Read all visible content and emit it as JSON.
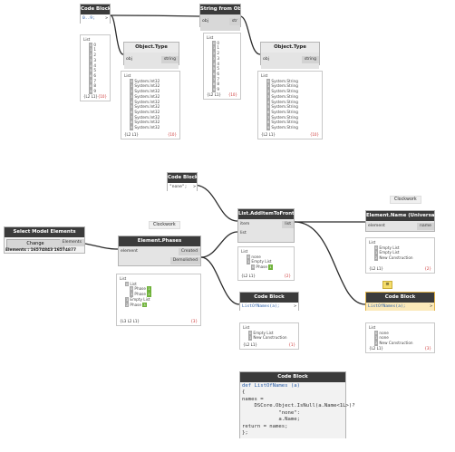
{
  "nodes": {
    "code_block_range": {
      "title": "Code Block",
      "code": "0..9;",
      "out": ">"
    },
    "string_from_object": {
      "title": "String from Object",
      "in": "obj",
      "out": "str"
    },
    "object_type_1": {
      "title": "Object.Type",
      "in": "obj",
      "out": "string"
    },
    "object_type_2": {
      "title": "Object.Type",
      "in": "obj",
      "out": "string"
    },
    "code_block_none": {
      "title": "Code Block",
      "code": "\"none\";",
      "out": ">"
    },
    "list_additemtofront": {
      "title": "List.AddItemToFront",
      "in1": "item",
      "in2": "list",
      "out": "list"
    },
    "element_name": {
      "title": "Element.Name (Universal)",
      "in": "element",
      "out": "name"
    },
    "select_model_elements": {
      "title": "Select Model Elements",
      "button": "Change",
      "out": "Elements",
      "status": "Elements : 16574843 16574877"
    },
    "element_phases": {
      "title": "Element.Phases",
      "in": "element",
      "out1": "Created",
      "out2": "Demolished"
    },
    "code_block_listofnames_1": {
      "title": "Code Block",
      "code": "ListOfNames(a);",
      "out": ">"
    },
    "code_block_listofnames_2": {
      "title": "Code Block",
      "code": "ListOfNames(a);",
      "out": ">"
    },
    "code_block_def": {
      "title": "Code Block"
    }
  },
  "labels": {
    "clockwork_1": "Clockwork",
    "clockwork_2": "Clockwork"
  },
  "previews": {
    "range": {
      "head": "List",
      "items": [
        "0",
        "1",
        "2",
        "3",
        "4",
        "5",
        "6",
        "7",
        "8",
        "9"
      ],
      "foot": "{L2 L1}",
      "count": "{10}"
    },
    "str": {
      "head": "List",
      "items": [
        "0",
        "1",
        "2",
        "3",
        "4",
        "5",
        "6",
        "7",
        "8",
        "9"
      ],
      "foot": "{L2 L1}",
      "count": "{10}"
    },
    "type1": {
      "head": "List",
      "items": [
        "System.Int32",
        "System.Int32",
        "System.Int32",
        "System.Int32",
        "System.Int32",
        "System.Int32",
        "System.Int32",
        "System.Int32",
        "System.Int32",
        "System.Int32"
      ],
      "foot": "{L2 L1}",
      "count": "{10}"
    },
    "type2": {
      "head": "List",
      "items": [
        "System.String",
        "System.String",
        "System.String",
        "System.String",
        "System.String",
        "System.String",
        "System.String",
        "System.String",
        "System.String",
        "System.String"
      ],
      "foot": "{L2 L1}",
      "count": "{10}"
    },
    "phases": {
      "head": "List",
      "sub": [
        "List",
        "Phase",
        "Phase",
        "Empty List",
        "Phase"
      ],
      "idx": [
        "0",
        "1",
        "2",
        "1",
        "0"
      ],
      "foot": "{L3 L2 L1}",
      "count": "{3}"
    },
    "additem": {
      "head": "List",
      "items": [
        "none",
        "Empty List",
        "Phase"
      ],
      "foot": "{L2 L1}",
      "count": "{2}"
    },
    "elname": {
      "head": "List",
      "items": [
        "Empty List",
        "Empty List",
        "New Construction"
      ],
      "foot": "{L2 L1}",
      "count": "{2}"
    },
    "cb1": {
      "head": "List",
      "items": [
        "Empty List",
        "New Construction"
      ],
      "foot": "{L2 L1}",
      "count": "{1}"
    },
    "cb2": {
      "head": "List",
      "items": [
        "none",
        "none",
        "New Construction"
      ],
      "foot": "{L2 L1}",
      "count": "{3}"
    }
  },
  "def_code": {
    "l1": "def ListOfNames (a)",
    "l2": "{",
    "l3": "names =",
    "l4": "    DSCore.Object.IsNull(a.Name<1L>)?",
    "l5": "            \"none\":",
    "l6": "            a.Name;",
    "l7": "return = names;",
    "l8": "};"
  }
}
